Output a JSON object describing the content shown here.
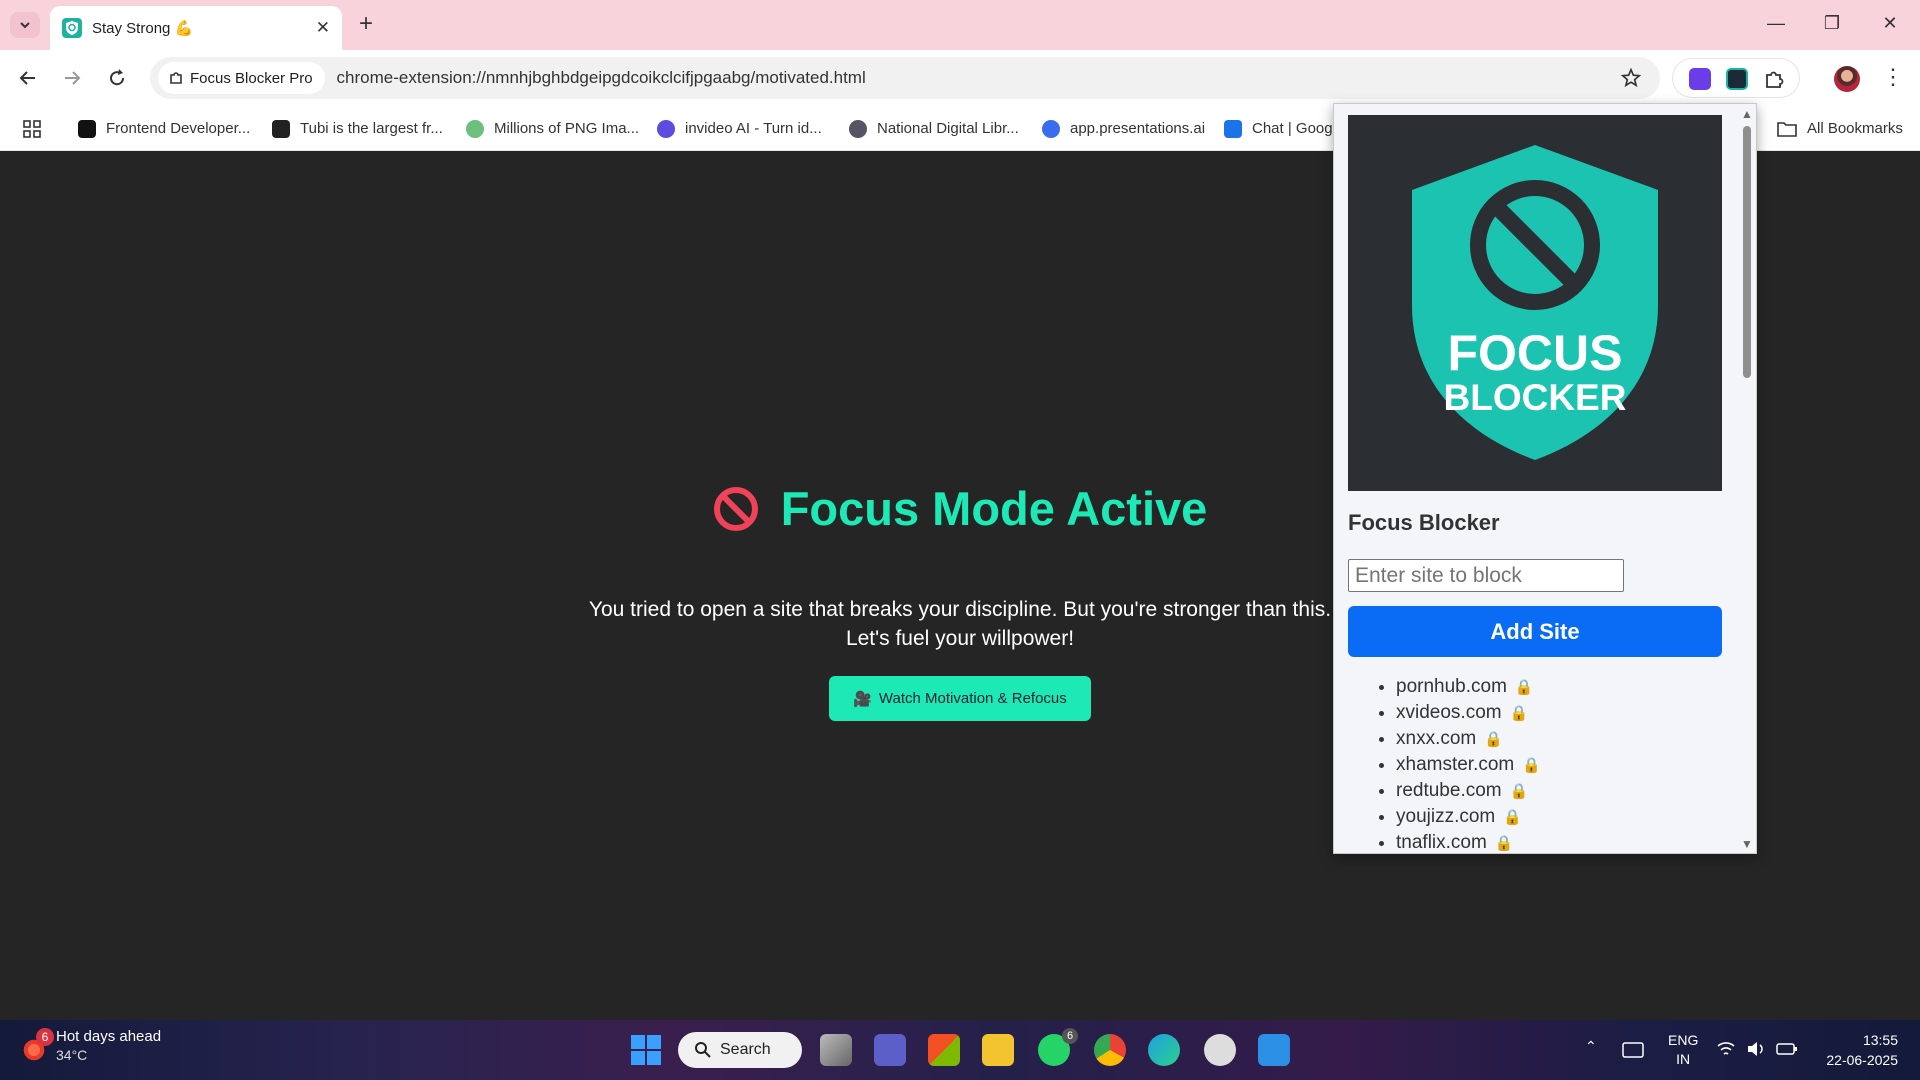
{
  "browser": {
    "tab_title": "Stay Strong 💪",
    "site_chip": "Focus Blocker Pro",
    "url": "chrome-extension://nmnhjbghbdgeipgdcoikclcifjpgaabg/motivated.html"
  },
  "bookmarks": [
    {
      "label": "Frontend Developer...",
      "icon": "frontend-icon"
    },
    {
      "label": "Tubi is the largest fr...",
      "icon": "tubi-icon"
    },
    {
      "label": "Millions of PNG Ima...",
      "icon": "png-icon"
    },
    {
      "label": "invideo AI - Turn id...",
      "icon": "invideo-icon"
    },
    {
      "label": "National Digital Libr...",
      "icon": "ndl-icon"
    },
    {
      "label": "app.presentations.ai",
      "icon": "presentations-icon"
    },
    {
      "label": "Chat | Googl",
      "icon": "chat-icon"
    }
  ],
  "all_bookmarks": "All Bookmarks",
  "page": {
    "heading": "Focus Mode Active",
    "line1": "You tried to open a site that breaks your discipline. But you're stronger than this.",
    "line2": "Let's fuel your willpower!",
    "button": "Watch Motivation & Refocus",
    "button_icon": "🎥"
  },
  "popup": {
    "logo_line1": "FOCUS",
    "logo_line2": "BLOCKER",
    "title": "Focus Blocker",
    "input_placeholder": "Enter site to block",
    "add_button": "Add Site",
    "lock_glyph": "🔒",
    "sites": [
      "pornhub.com",
      "xvideos.com",
      "xnxx.com",
      "xhamster.com",
      "redtube.com",
      "youjizz.com",
      "tnaflix.com"
    ]
  },
  "taskbar": {
    "weather_title": "Hot days ahead",
    "weather_temp": "34°C",
    "weather_badge": "6",
    "search": "Search",
    "whatsapp_badge": "6",
    "lang1": "ENG",
    "lang2": "IN",
    "time": "13:55",
    "date": "22-06-2025"
  },
  "colors": {
    "accent": "#1de9b6",
    "page_bg": "#252525",
    "add_button": "#0a6cf5",
    "tab_strip": "#f9d3dc"
  }
}
